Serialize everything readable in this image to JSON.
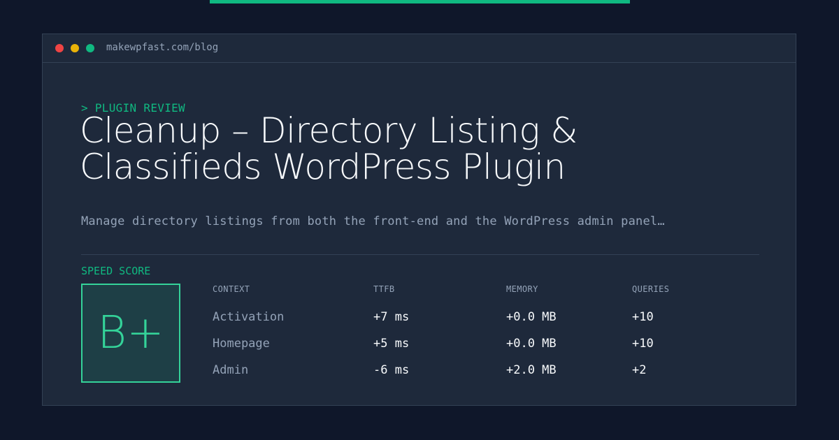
{
  "window": {
    "url": "makewpfast.com/blog",
    "dots": [
      {
        "name": "close",
        "color": "#ef4444"
      },
      {
        "name": "minimize",
        "color": "#eab308"
      },
      {
        "name": "maximize",
        "color": "#10b981"
      }
    ]
  },
  "article": {
    "eyebrow": "> PLUGIN REVIEW",
    "title": "Cleanup – Directory Listing & Classifieds WordPress Plugin",
    "description": "Manage directory listings from both the front-end and the WordPress admin panel…"
  },
  "score": {
    "label": "SPEED SCORE",
    "grade": "B+"
  },
  "metrics": {
    "headers": {
      "context": "CONTEXT",
      "ttfb": "TTFB",
      "memory": "MEMORY",
      "queries": "QUERIES"
    },
    "rows": [
      {
        "context": "Activation",
        "ttfb": "+7 ms",
        "memory": "+0.0 MB",
        "queries": "+10"
      },
      {
        "context": "Homepage",
        "ttfb": "+5 ms",
        "memory": "+0.0 MB",
        "queries": "+10"
      },
      {
        "context": "Admin",
        "ttfb": "-6 ms",
        "memory": "+2.0 MB",
        "queries": "+2"
      }
    ]
  },
  "colors": {
    "background": "#0f172a",
    "panel": "#1e293b",
    "accent": "#10b981",
    "grade": "#34d399",
    "muted_text": "#94a3b8",
    "text": "#f8fafc"
  }
}
